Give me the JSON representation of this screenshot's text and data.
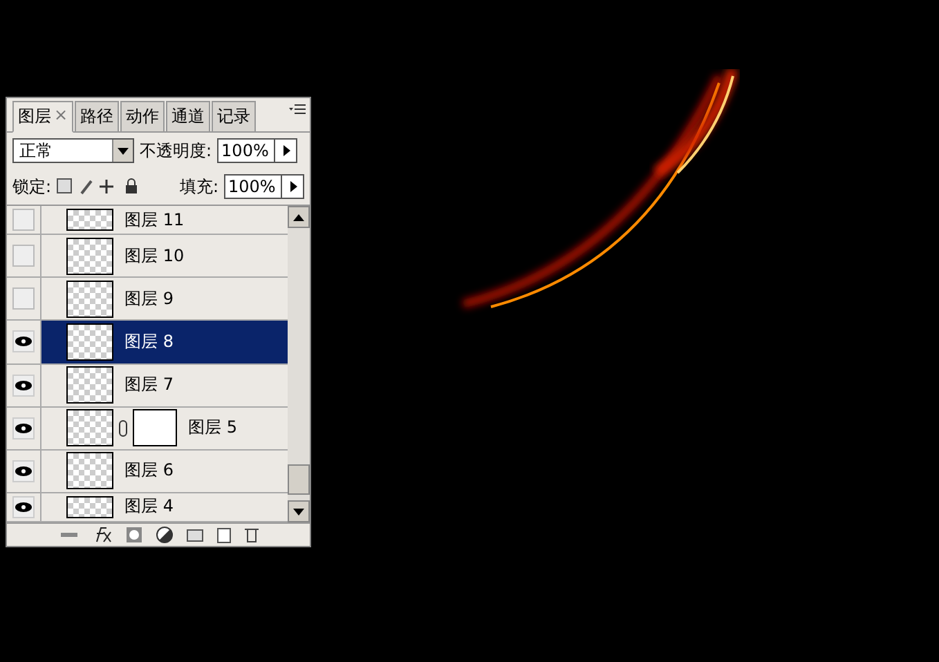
{
  "panel": {
    "tabs": [
      {
        "label": "图层",
        "selected": true,
        "close": "×"
      },
      {
        "label": "路径",
        "selected": false
      },
      {
        "label": "动作",
        "selected": false
      },
      {
        "label": "通道",
        "selected": false
      },
      {
        "label": "记录",
        "selected": false
      }
    ],
    "blend_mode": "正常",
    "opacity_label": "不透明度:",
    "opacity": "100%",
    "lock_label": "锁定:",
    "fill_label": "填充:",
    "fill": "100%",
    "layers": [
      {
        "name": "图层 11",
        "visible": false,
        "selected": false,
        "kind": "plain"
      },
      {
        "name": "图层 10",
        "visible": false,
        "selected": false,
        "kind": "plain"
      },
      {
        "name": "图层 9",
        "visible": false,
        "selected": false,
        "kind": "plain"
      },
      {
        "name": "图层 8",
        "visible": true,
        "selected": true,
        "kind": "plain"
      },
      {
        "name": "图层 7",
        "visible": true,
        "selected": false,
        "kind": "plain"
      },
      {
        "name": "图层 5",
        "visible": true,
        "selected": false,
        "kind": "masked"
      },
      {
        "name": "图层 6",
        "visible": true,
        "selected": false,
        "kind": "plain"
      },
      {
        "name": "图层 4",
        "visible": true,
        "selected": false,
        "kind": "plain"
      }
    ]
  }
}
